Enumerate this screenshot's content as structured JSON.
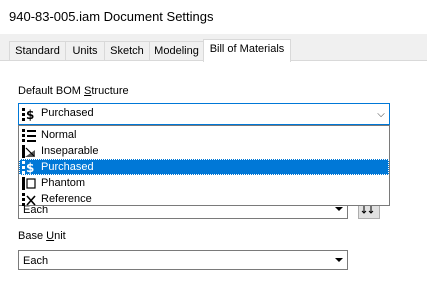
{
  "window": {
    "title": "940-83-005.iam Document Settings"
  },
  "tabs": [
    {
      "label": "Standard"
    },
    {
      "label": "Units"
    },
    {
      "label": "Sketch"
    },
    {
      "label": "Modeling"
    },
    {
      "label": "Bill of Materials",
      "active": true
    }
  ],
  "bom": {
    "label_prefix": "Default BOM ",
    "label_accel": "S",
    "label_suffix": "tructure",
    "selected": "Purchased",
    "options": [
      {
        "label": "Normal",
        "icon": "normal-structure-icon"
      },
      {
        "label": "Inseparable",
        "icon": "inseparable-structure-icon"
      },
      {
        "label": "Purchased",
        "icon": "purchased-structure-icon",
        "selected": true
      },
      {
        "label": "Phantom",
        "icon": "phantom-structure-icon"
      },
      {
        "label": "Reference",
        "icon": "reference-structure-icon"
      }
    ]
  },
  "quantity": {
    "value": "Each"
  },
  "base_unit": {
    "label_prefix": "Base ",
    "label_accel": "U",
    "label_suffix": "nit",
    "value": "Each"
  },
  "colors": {
    "accent": "#0078d7",
    "panel": "#f0f0f0"
  }
}
